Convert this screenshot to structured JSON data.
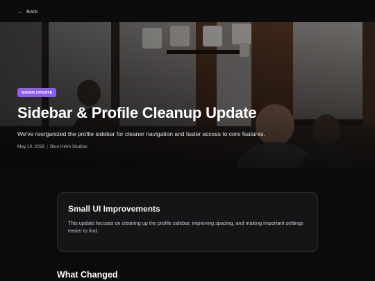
{
  "nav": {
    "back_label": "Back"
  },
  "hero": {
    "badge": "MINOR UPDATE",
    "title": "Sidebar & Profile Cleanup Update",
    "subtitle": "We've reorganized the profile sidebar for cleaner navigation and faster access to core features.",
    "date": "May 10, 2026",
    "separator": "|",
    "author": "Blue Helm Studios"
  },
  "card": {
    "title": "Small UI Improvements",
    "body": "This update focuses on cleaning up the profile sidebar, improving spacing, and making important settings easier to find."
  },
  "section": {
    "title": "What Changed"
  },
  "colors": {
    "accent": "#8b5cf6",
    "background": "#0b0b0c",
    "card": "#151518"
  }
}
